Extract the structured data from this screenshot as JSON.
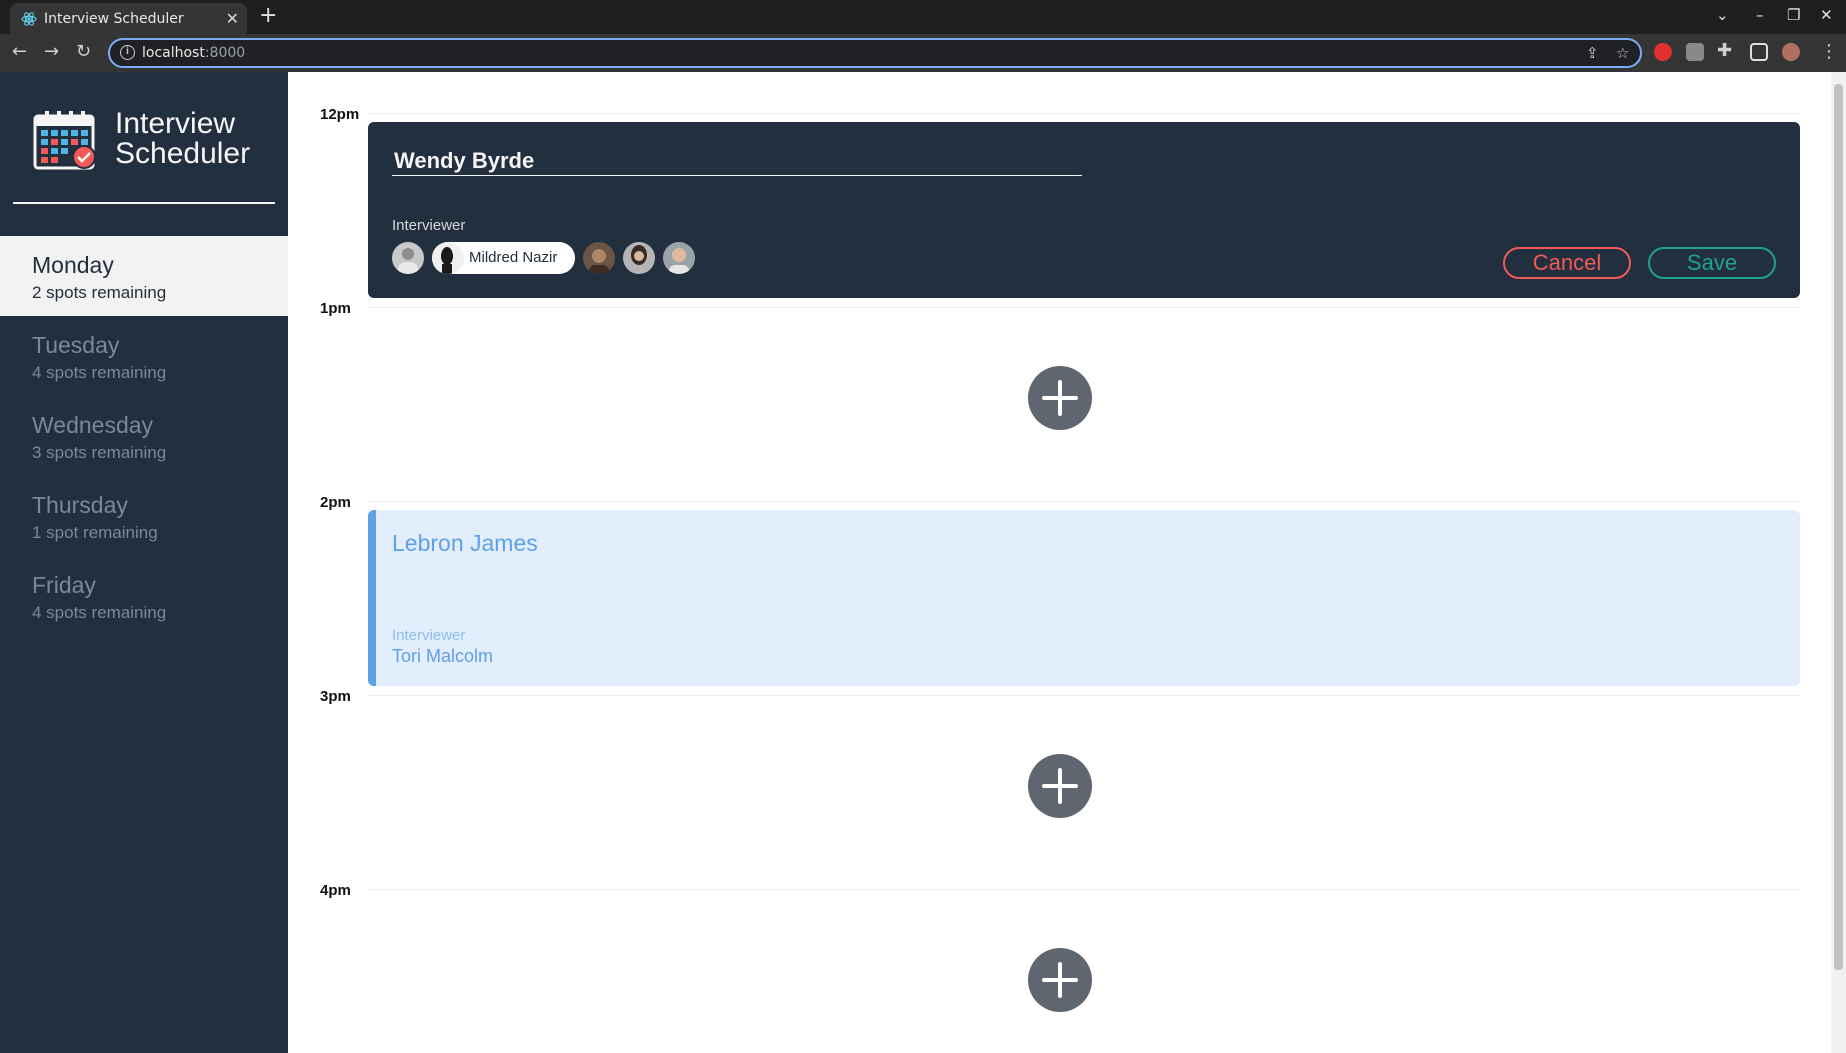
{
  "browser": {
    "tab_title": "Interview Scheduler",
    "new_tab_symbol": "+",
    "url_host": "localhost",
    "url_port": ":8000"
  },
  "app": {
    "brand_line1": "Interview",
    "brand_line2": "Scheduler"
  },
  "days": [
    {
      "name": "Monday",
      "spots": "2 spots remaining",
      "selected": true
    },
    {
      "name": "Tuesday",
      "spots": "4 spots remaining",
      "selected": false
    },
    {
      "name": "Wednesday",
      "spots": "3 spots remaining",
      "selected": false
    },
    {
      "name": "Thursday",
      "spots": "1 spot remaining",
      "selected": false
    },
    {
      "name": "Friday",
      "spots": "4 spots remaining",
      "selected": false
    }
  ],
  "schedule": {
    "times": [
      "12pm",
      "1pm",
      "2pm",
      "3pm",
      "4pm"
    ],
    "form": {
      "student_value": "Wendy Byrde",
      "interviewer_label": "Interviewer",
      "selected_interviewer": "Mildred Nazir",
      "cancel_label": "Cancel",
      "save_label": "Save"
    },
    "booked": {
      "student": "Lebron James",
      "interviewer_label": "Interviewer",
      "interviewer": "Tori Malcolm"
    }
  },
  "colors": {
    "sidebar_bg": "#222f3e",
    "cancel": "#f25a59",
    "save": "#20a38c",
    "booked_accent": "#5fa0e6",
    "booked_bg": "#e2eefc",
    "add_button": "#5f6670"
  }
}
